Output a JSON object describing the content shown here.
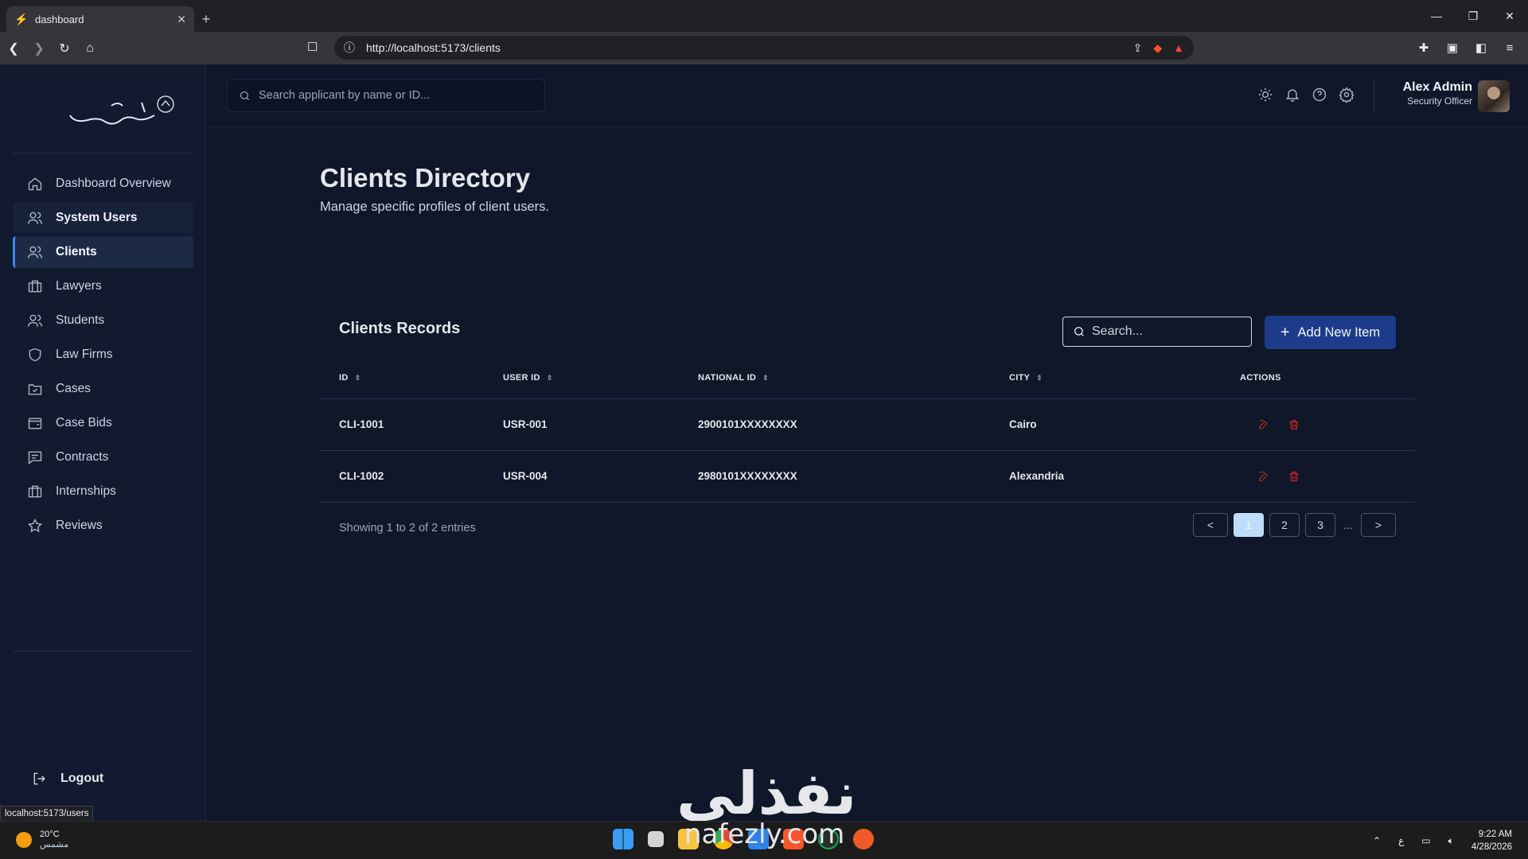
{
  "browser": {
    "tab_title": "dashboard",
    "url": "http://localhost:5173/clients",
    "status_url": "localhost:5173/users"
  },
  "sidebar": {
    "items": [
      {
        "label": "Dashboard Overview",
        "icon": "home-icon"
      },
      {
        "label": "System Users",
        "icon": "users-icon"
      },
      {
        "label": "Clients",
        "icon": "users-icon"
      },
      {
        "label": "Lawyers",
        "icon": "briefcase-icon"
      },
      {
        "label": "Students",
        "icon": "users-icon"
      },
      {
        "label": "Law Firms",
        "icon": "shield-icon"
      },
      {
        "label": "Cases",
        "icon": "folder-icon"
      },
      {
        "label": "Case Bids",
        "icon": "wallet-icon"
      },
      {
        "label": "Contracts",
        "icon": "message-icon"
      },
      {
        "label": "Internships",
        "icon": "briefcase-icon"
      },
      {
        "label": "Reviews",
        "icon": "star-icon"
      }
    ],
    "logout_label": "Logout"
  },
  "header": {
    "search_placeholder": "Search applicant by name or ID...",
    "user_name": "Alex Admin",
    "user_role": "Security Officer"
  },
  "page": {
    "title": "Clients Directory",
    "subtitle": "Manage specific profiles of client users."
  },
  "table": {
    "title": "Clients Records",
    "search_placeholder": "Search...",
    "add_label": "Add New Item",
    "columns": [
      "ID",
      "USER ID",
      "NATIONAL ID",
      "CITY",
      "ACTIONS"
    ],
    "rows": [
      {
        "id": "CLI-1001",
        "user_id": "USR-001",
        "national_id": "2900101XXXXXXXX",
        "city": "Cairo"
      },
      {
        "id": "CLI-1002",
        "user_id": "USR-004",
        "national_id": "2980101XXXXXXXX",
        "city": "Alexandria"
      }
    ],
    "showing": "Showing 1 to 2 of 2 entries",
    "pages": [
      "<",
      "1",
      "2",
      "3",
      "...",
      ">"
    ]
  },
  "watermark": {
    "line1": "نفذلي",
    "line2": "nafezly.com"
  },
  "taskbar": {
    "temp": "20°C",
    "weather": "مشمس",
    "lang": "ع",
    "time": "9:22 AM",
    "date": "4/28/2026"
  },
  "colors": {
    "accent": "#1e3a8a",
    "bg": "#0f1729",
    "sidebar": "#111a2e",
    "delete": "#dc2626"
  }
}
